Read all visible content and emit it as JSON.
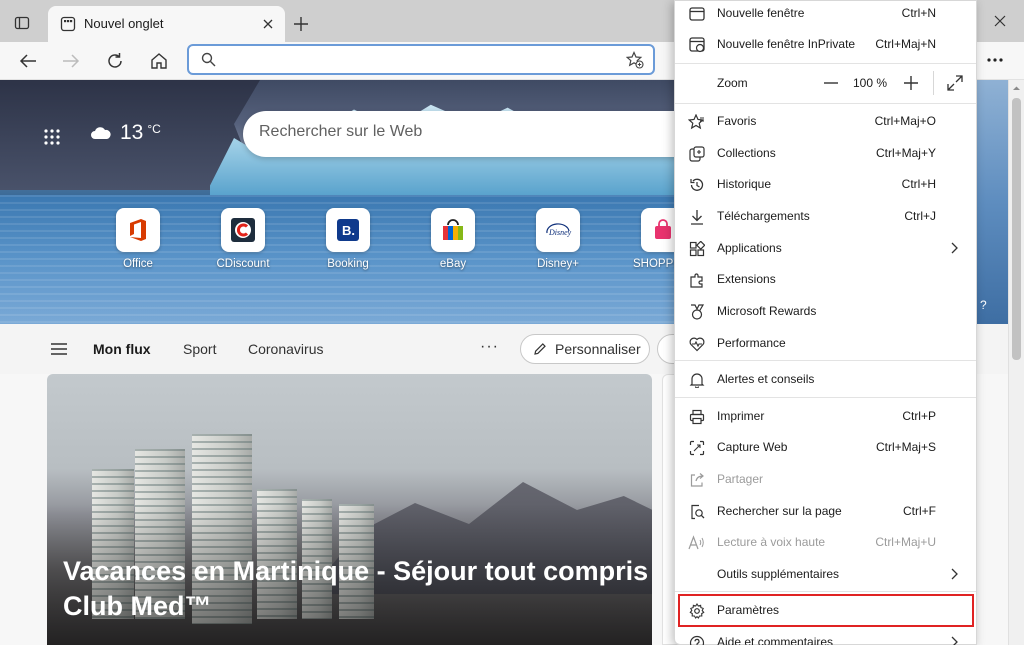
{
  "browser": {
    "tab_title": "Nouvel onglet",
    "address_value": "",
    "colors": {
      "highlight": "#e02323",
      "address_focus": "#6b9bd8"
    }
  },
  "newtab": {
    "search_placeholder": "Rechercher sur le Web",
    "weather": {
      "temp": "13",
      "unit": "°C",
      "icon": "cloud-icon"
    },
    "quick_links": [
      {
        "label": "Office",
        "icon": "office-icon"
      },
      {
        "label": "CDiscount",
        "icon": "cdiscount-icon"
      },
      {
        "label": "Booking",
        "icon": "booking-icon"
      },
      {
        "label": "eBay",
        "icon": "ebay-icon"
      },
      {
        "label": "Disney+",
        "icon": "disney-icon"
      },
      {
        "label": "SHOPPI",
        "icon": "shopping-icon"
      }
    ],
    "help_text": "?",
    "feed": {
      "tabs": [
        "Mon flux",
        "Sport",
        "Coronavirus"
      ],
      "more": "···",
      "personalize": "Personnaliser"
    },
    "headline": "Vacances en Martinique - Séjour tout compris Club Med™"
  },
  "menu": {
    "items_top": [
      {
        "label": "Nouvelle fenêtre",
        "shortcut": "Ctrl+N",
        "icon": "window-icon"
      },
      {
        "label": "Nouvelle fenêtre InPrivate",
        "shortcut": "Ctrl+Maj+N",
        "icon": "inprivate-icon"
      }
    ],
    "zoom": {
      "label": "Zoom",
      "value": "100 %"
    },
    "items_mid": [
      {
        "label": "Favoris",
        "shortcut": "Ctrl+Maj+O",
        "icon": "favorites-icon"
      },
      {
        "label": "Collections",
        "shortcut": "Ctrl+Maj+Y",
        "icon": "collections-icon"
      },
      {
        "label": "Historique",
        "shortcut": "Ctrl+H",
        "icon": "history-icon"
      },
      {
        "label": "Téléchargements",
        "shortcut": "Ctrl+J",
        "icon": "download-icon"
      },
      {
        "label": "Applications",
        "shortcut": "",
        "icon": "apps-icon",
        "submenu": true
      },
      {
        "label": "Extensions",
        "shortcut": "",
        "icon": "extensions-icon"
      },
      {
        "label": "Microsoft Rewards",
        "shortcut": "",
        "icon": "rewards-icon"
      },
      {
        "label": "Performance",
        "shortcut": "",
        "icon": "performance-icon"
      }
    ],
    "alerts": {
      "label": "Alertes et conseils",
      "icon": "bell-icon"
    },
    "items_low": [
      {
        "label": "Imprimer",
        "shortcut": "Ctrl+P",
        "icon": "print-icon"
      },
      {
        "label": "Capture Web",
        "shortcut": "Ctrl+Maj+S",
        "icon": "capture-icon"
      },
      {
        "label": "Partager",
        "shortcut": "",
        "icon": "share-icon",
        "disabled": true
      },
      {
        "label": "Rechercher sur la page",
        "shortcut": "Ctrl+F",
        "icon": "find-icon"
      },
      {
        "label": "Lecture à voix haute",
        "shortcut": "Ctrl+Maj+U",
        "icon": "read-aloud-icon",
        "disabled": true
      },
      {
        "label": "Outils supplémentaires",
        "shortcut": "",
        "icon": "",
        "submenu": true
      }
    ],
    "settings": {
      "label": "Paramètres",
      "icon": "gear-icon"
    },
    "help": {
      "label": "Aide et commentaires",
      "icon": "help-icon"
    }
  }
}
